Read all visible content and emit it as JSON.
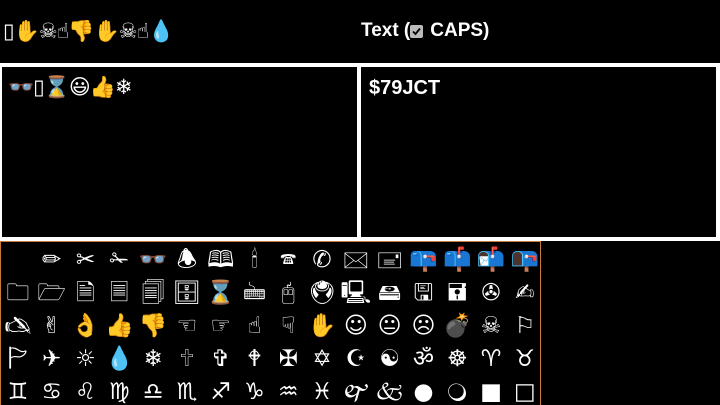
{
  "header": {
    "emoji_sequence": "▯✋☠☝👎✋☠☝💧",
    "title_text": "Text (",
    "caps_label": "CAPS)",
    "caps_checked": true
  },
  "left_panel": {
    "emoji_text": "👓▯⌛😃👍❄"
  },
  "right_panel": {
    "output_text": "$79JCT"
  },
  "keyboard": {
    "rows": [
      [
        "",
        "✏",
        "✂",
        "✁",
        "👓",
        "🕭",
        "🕮",
        "🕯",
        "🕿",
        "✆",
        "🖂",
        "🖃",
        "📪",
        "📫",
        "📬",
        "📭"
      ],
      [
        "🗀",
        "🗁",
        "🗎",
        "🗏",
        "🗐",
        "🗄",
        "⌛",
        "🖮",
        "🖰",
        "🖲",
        "🖳",
        "🖴",
        "🖫",
        "🖬",
        "✇",
        "✍"
      ],
      [
        "🖎",
        "✌",
        "👌",
        "👍",
        "👎",
        "☜",
        "☞",
        "☝",
        "☟",
        "✋",
        "☺",
        "😐",
        "☹",
        "💣",
        "☠",
        "⚐"
      ],
      [
        "🏱",
        "✈",
        "☼",
        "💧",
        "❄",
        "🕆",
        "✞",
        "🕈",
        "✠",
        "✡",
        "☪",
        "☯",
        "ॐ",
        "☸",
        "♈",
        "♉"
      ],
      [
        "♊",
        "♋",
        "♌",
        "♍",
        "♎",
        "♏",
        "♐",
        "♑",
        "♒",
        "♓",
        "🙰",
        "🙵",
        "●",
        "🔾",
        "■",
        "□"
      ]
    ]
  },
  "colors": {
    "background": "#000000",
    "divider": "#ffffff",
    "keyboard_border": "#c77a3a",
    "text": "#ffffff"
  }
}
